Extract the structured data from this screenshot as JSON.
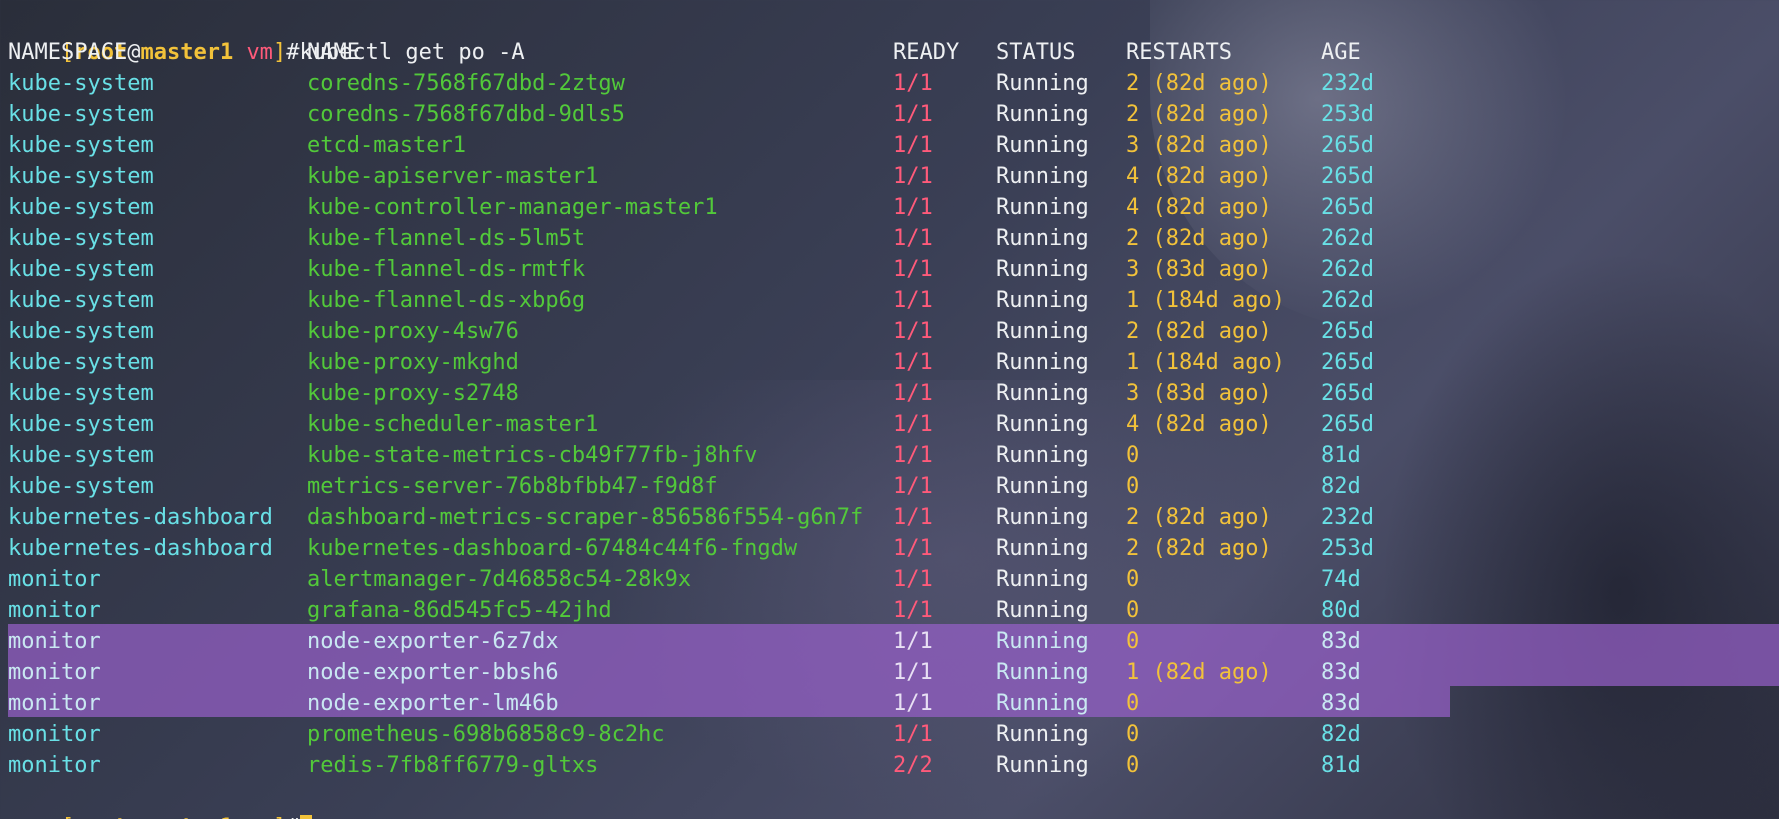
{
  "terminal": {
    "prompt": {
      "open_bracket": "[",
      "user": "root",
      "at": "@",
      "host": "master1",
      "dir": "vm",
      "close_bracket": "]",
      "hash": "#"
    },
    "command": "kubectl get po -A",
    "headers": {
      "namespace": "NAMESPACE",
      "name": "NAME",
      "ready": "READY",
      "status": "STATUS",
      "restarts": "RESTARTS",
      "age": "AGE"
    },
    "pods": [
      {
        "namespace": "kube-system",
        "name": "coredns-7568f67dbd-2ztgw",
        "ready": "1/1",
        "status": "Running",
        "restarts": "2 (82d ago)",
        "age": "232d"
      },
      {
        "namespace": "kube-system",
        "name": "coredns-7568f67dbd-9dls5",
        "ready": "1/1",
        "status": "Running",
        "restarts": "2 (82d ago)",
        "age": "253d"
      },
      {
        "namespace": "kube-system",
        "name": "etcd-master1",
        "ready": "1/1",
        "status": "Running",
        "restarts": "3 (82d ago)",
        "age": "265d"
      },
      {
        "namespace": "kube-system",
        "name": "kube-apiserver-master1",
        "ready": "1/1",
        "status": "Running",
        "restarts": "4 (82d ago)",
        "age": "265d"
      },
      {
        "namespace": "kube-system",
        "name": "kube-controller-manager-master1",
        "ready": "1/1",
        "status": "Running",
        "restarts": "4 (82d ago)",
        "age": "265d"
      },
      {
        "namespace": "kube-system",
        "name": "kube-flannel-ds-5lm5t",
        "ready": "1/1",
        "status": "Running",
        "restarts": "2 (82d ago)",
        "age": "262d"
      },
      {
        "namespace": "kube-system",
        "name": "kube-flannel-ds-rmtfk",
        "ready": "1/1",
        "status": "Running",
        "restarts": "3 (83d ago)",
        "age": "262d"
      },
      {
        "namespace": "kube-system",
        "name": "kube-flannel-ds-xbp6g",
        "ready": "1/1",
        "status": "Running",
        "restarts": "1 (184d ago)",
        "age": "262d"
      },
      {
        "namespace": "kube-system",
        "name": "kube-proxy-4sw76",
        "ready": "1/1",
        "status": "Running",
        "restarts": "2 (82d ago)",
        "age": "265d"
      },
      {
        "namespace": "kube-system",
        "name": "kube-proxy-mkghd",
        "ready": "1/1",
        "status": "Running",
        "restarts": "1 (184d ago)",
        "age": "265d"
      },
      {
        "namespace": "kube-system",
        "name": "kube-proxy-s2748",
        "ready": "1/1",
        "status": "Running",
        "restarts": "3 (83d ago)",
        "age": "265d"
      },
      {
        "namespace": "kube-system",
        "name": "kube-scheduler-master1",
        "ready": "1/1",
        "status": "Running",
        "restarts": "4 (82d ago)",
        "age": "265d"
      },
      {
        "namespace": "kube-system",
        "name": "kube-state-metrics-cb49f77fb-j8hfv",
        "ready": "1/1",
        "status": "Running",
        "restarts": "0",
        "age": "81d"
      },
      {
        "namespace": "kube-system",
        "name": "metrics-server-76b8bfbb47-f9d8f",
        "ready": "1/1",
        "status": "Running",
        "restarts": "0",
        "age": "82d"
      },
      {
        "namespace": "kubernetes-dashboard",
        "name": "dashboard-metrics-scraper-856586f554-g6n7f",
        "ready": "1/1",
        "status": "Running",
        "restarts": "2 (82d ago)",
        "age": "232d"
      },
      {
        "namespace": "kubernetes-dashboard",
        "name": "kubernetes-dashboard-67484c44f6-fngdw",
        "ready": "1/1",
        "status": "Running",
        "restarts": "2 (82d ago)",
        "age": "253d"
      },
      {
        "namespace": "monitor",
        "name": "alertmanager-7d46858c54-28k9x",
        "ready": "1/1",
        "status": "Running",
        "restarts": "0",
        "age": "74d"
      },
      {
        "namespace": "monitor",
        "name": "grafana-86d545fc5-42jhd",
        "ready": "1/1",
        "status": "Running",
        "restarts": "0",
        "age": "80d"
      },
      {
        "namespace": "monitor",
        "name": "node-exporter-6z7dx",
        "ready": "1/1",
        "status": "Running",
        "restarts": "0",
        "age": "83d"
      },
      {
        "namespace": "monitor",
        "name": "node-exporter-bbsh6",
        "ready": "1/1",
        "status": "Running",
        "restarts": "1 (82d ago)",
        "age": "83d"
      },
      {
        "namespace": "monitor",
        "name": "node-exporter-lm46b",
        "ready": "1/1",
        "status": "Running",
        "restarts": "0",
        "age": "83d"
      },
      {
        "namespace": "monitor",
        "name": "prometheus-698b6858c9-8c2hc",
        "ready": "1/1",
        "status": "Running",
        "restarts": "0",
        "age": "82d"
      },
      {
        "namespace": "monitor",
        "name": "redis-7fb8ff6779-gltxs",
        "ready": "2/2",
        "status": "Running",
        "restarts": "0",
        "age": "81d"
      }
    ]
  }
}
